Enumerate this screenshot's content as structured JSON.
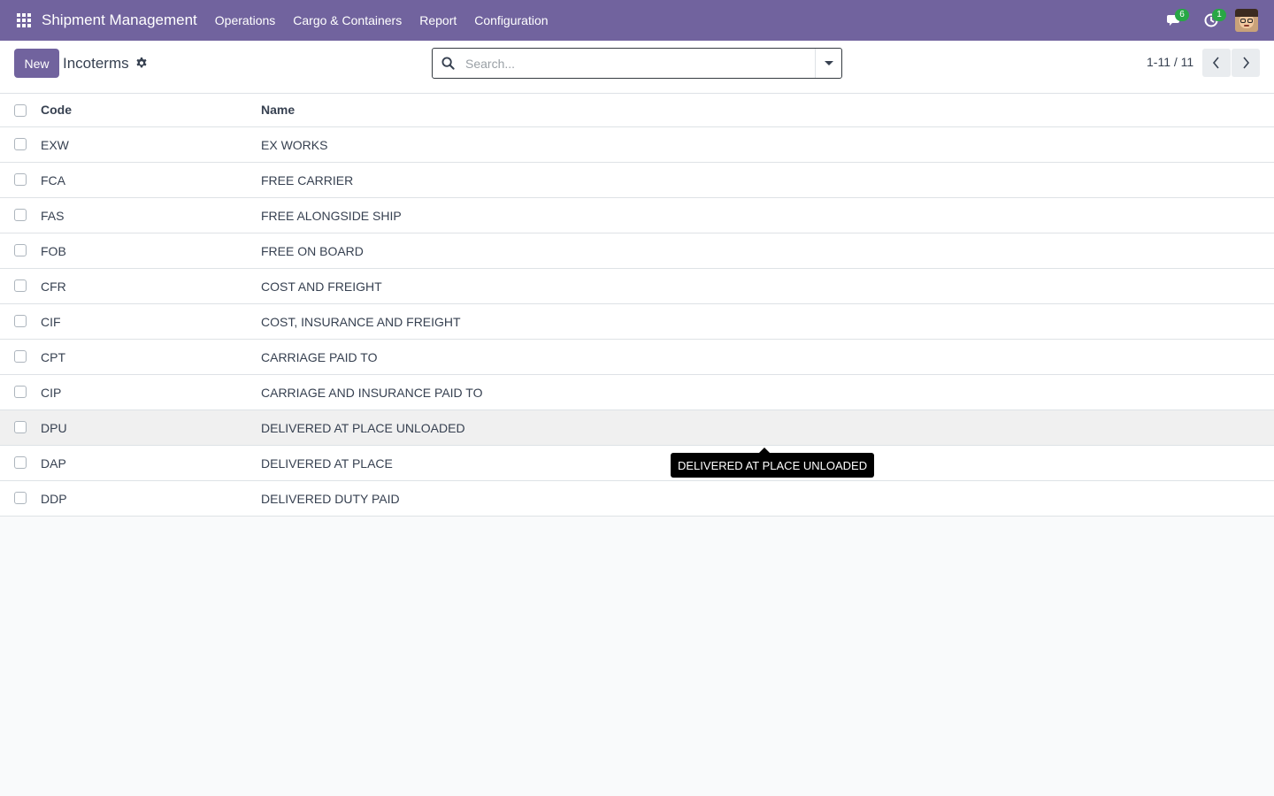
{
  "navbar": {
    "app_title": "Shipment Management",
    "menu": [
      {
        "label": "Operations"
      },
      {
        "label": "Cargo & Containers"
      },
      {
        "label": "Report"
      },
      {
        "label": "Configuration"
      }
    ],
    "messages_badge": "6",
    "activities_badge": "1",
    "icons": {
      "apps": "apps-grid-icon",
      "messages": "chat-icon",
      "activities": "clock-icon",
      "avatar": "user-avatar"
    },
    "bg_color": "#71639e"
  },
  "control": {
    "new_label": "New",
    "breadcrumb": "Incoterms",
    "search_placeholder": "Search...",
    "pager": "1-11 / 11"
  },
  "list": {
    "headers": {
      "code": "Code",
      "name": "Name"
    },
    "rows": [
      {
        "code": "EXW",
        "name": "EX WORKS"
      },
      {
        "code": "FCA",
        "name": "FREE CARRIER"
      },
      {
        "code": "FAS",
        "name": "FREE ALONGSIDE SHIP"
      },
      {
        "code": "FOB",
        "name": "FREE ON BOARD"
      },
      {
        "code": "CFR",
        "name": "COST AND FREIGHT"
      },
      {
        "code": "CIF",
        "name": "COST, INSURANCE AND FREIGHT"
      },
      {
        "code": "CPT",
        "name": "CARRIAGE PAID TO"
      },
      {
        "code": "CIP",
        "name": "CARRIAGE AND INSURANCE PAID TO"
      },
      {
        "code": "DPU",
        "name": "DELIVERED AT PLACE UNLOADED"
      },
      {
        "code": "DAP",
        "name": "DELIVERED AT PLACE"
      },
      {
        "code": "DDP",
        "name": "DELIVERED DUTY PAID"
      }
    ]
  },
  "tooltip": {
    "text": "DELIVERED AT PLACE UNLOADED"
  }
}
